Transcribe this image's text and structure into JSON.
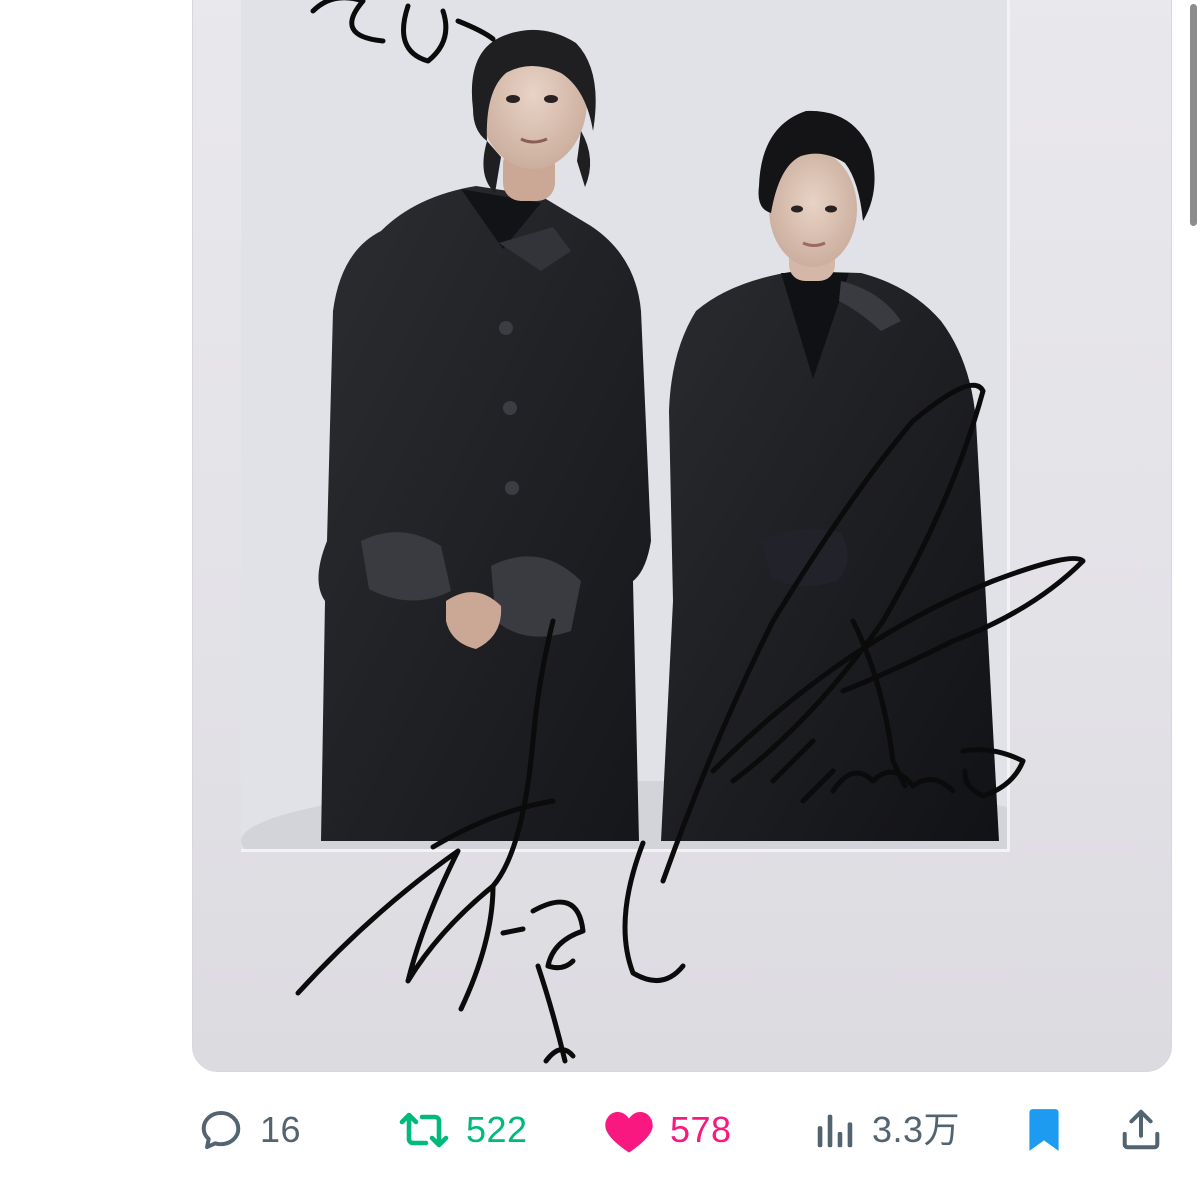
{
  "tweet": {
    "media": {
      "signature_text": [
        "Ryo",
        "NAOTO"
      ]
    },
    "actions": {
      "reply": {
        "icon": "reply-icon",
        "count": "16",
        "color": "#536471"
      },
      "retweet": {
        "icon": "retweet-icon",
        "count": "522",
        "color": "#00ba7c"
      },
      "like": {
        "icon": "heart-icon",
        "count": "578",
        "color": "#f91880",
        "liked": true
      },
      "views": {
        "icon": "analytics-icon",
        "count": "3.3万",
        "color": "#536471"
      },
      "bookmark": {
        "icon": "bookmark-icon",
        "color": "#1d9bf0",
        "bookmarked": true
      },
      "share": {
        "icon": "share-icon",
        "color": "#536471"
      }
    }
  },
  "colors": {
    "background": "#ffffff",
    "photo_frame": "#e6e5ea",
    "ink": "#0b0b0b"
  }
}
